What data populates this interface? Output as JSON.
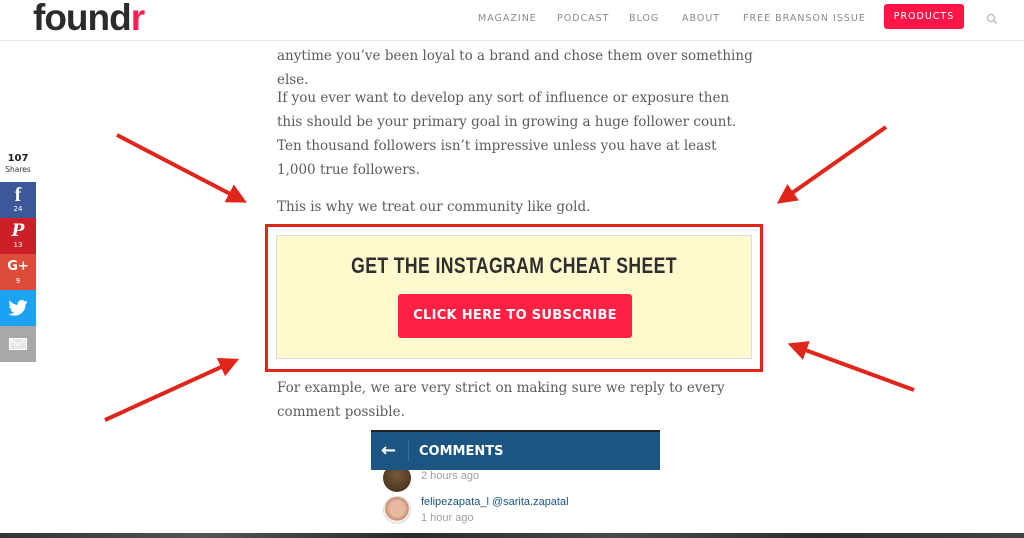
{
  "header": {
    "logo_main": "found",
    "logo_accent": "r",
    "nav": [
      {
        "label": "MAGAZINE"
      },
      {
        "label": "PODCAST"
      },
      {
        "label": "BLOG"
      },
      {
        "label": "ABOUT"
      },
      {
        "label": "FREE BRANSON ISSUE"
      }
    ],
    "products_label": "PRODUCTS",
    "search_icon": "search-icon"
  },
  "share_bar": {
    "total": "107",
    "total_label": "Shares",
    "buttons": [
      {
        "network": "facebook",
        "glyph": "f",
        "count": "24",
        "color": "#3b5998"
      },
      {
        "network": "pinterest",
        "glyph": "P",
        "count": "13",
        "color": "#cb2027"
      },
      {
        "network": "google-plus",
        "glyph": "G+",
        "count": "9",
        "color": "#dd4b39"
      },
      {
        "network": "twitter",
        "glyph": "twitter-bird-icon",
        "count": "",
        "color": "#1da1f2"
      },
      {
        "network": "email",
        "glyph": "envelope-icon",
        "count": "",
        "color": "#a8a8a8"
      }
    ]
  },
  "article": {
    "paragraphs": [
      "anytime you’ve been loyal to a brand and chose them over something else.",
      "If you ever want to develop any sort of influence or exposure then this should be your primary goal in growing a huge follower count. Ten thousand followers isn’t impressive unless you have at least 1,000 true followers.",
      "This is why we treat our community like gold.",
      "For example, we are very strict on making sure we reply to every comment possible."
    ]
  },
  "cta": {
    "title": "GET THE INSTAGRAM CHEAT SHEET",
    "button_label": "CLICK HERE TO SUBSCRIBE",
    "background": "#fffacd",
    "button_color": "#ff2044",
    "highlight_color": "#e0251b"
  },
  "instagram_embed": {
    "header_title": "COMMENTS",
    "back_icon": "arrow-left-icon",
    "comments": [
      {
        "user": "",
        "mention": "",
        "time": "2 hours ago"
      },
      {
        "user": "felipezapata_l",
        "mention": "@sarita.zapatal",
        "time": "1 hour ago"
      }
    ]
  },
  "brand_colors": {
    "accent": "#ff1548",
    "text": "#5b5b5b",
    "instagram_blue": "#1b5584"
  }
}
